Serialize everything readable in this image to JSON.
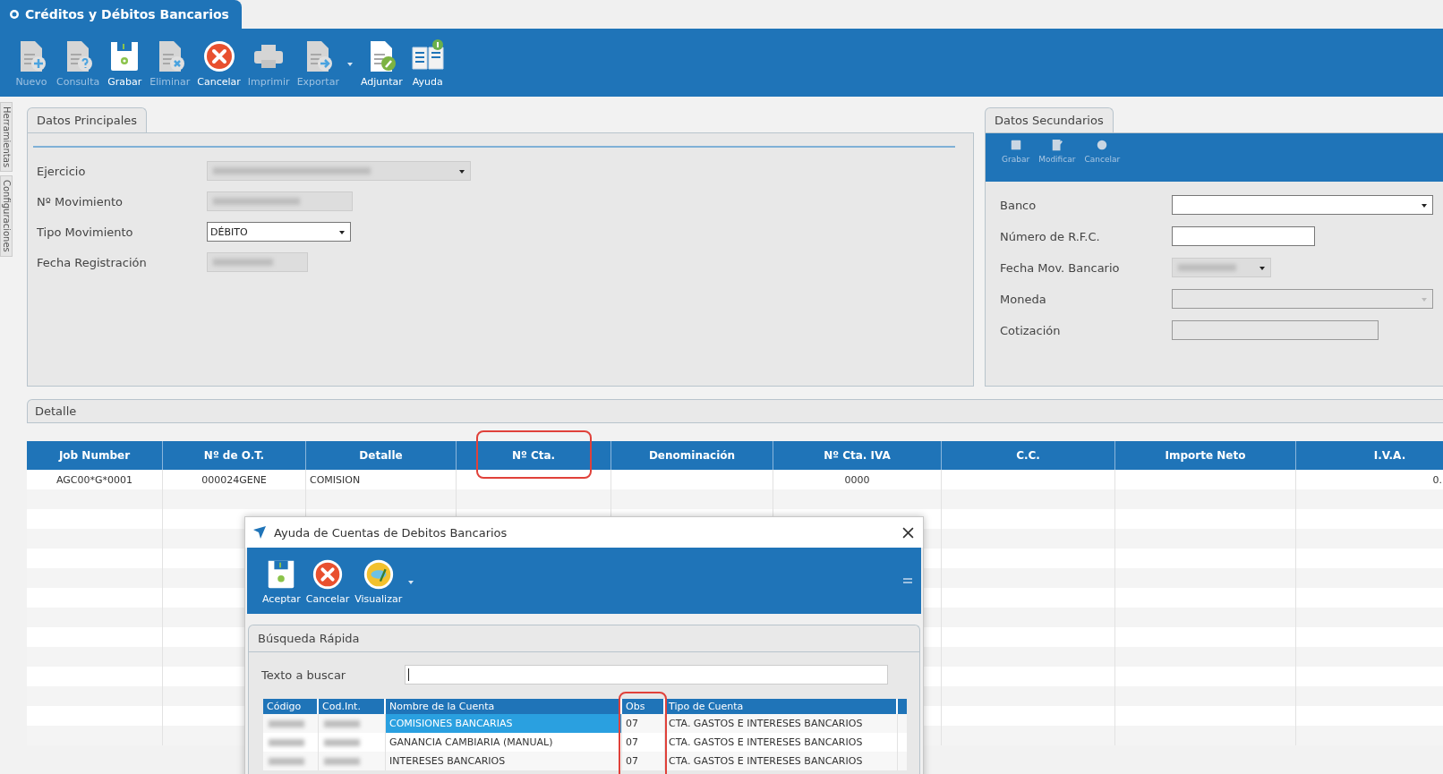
{
  "window": {
    "title": "Créditos y Débitos Bancarios"
  },
  "toolbar": [
    {
      "label": "Nuevo",
      "kind": "doc-plus",
      "disabled": true
    },
    {
      "label": "Consulta",
      "kind": "doc-question",
      "disabled": true
    },
    {
      "label": "Grabar",
      "kind": "save",
      "disabled": false
    },
    {
      "label": "Eliminar",
      "kind": "doc-x",
      "disabled": true
    },
    {
      "label": "Cancelar",
      "kind": "cancel",
      "disabled": false
    },
    {
      "label": "Imprimir",
      "kind": "printer",
      "disabled": true
    },
    {
      "label": "Exportar",
      "kind": "doc-arrow",
      "disabled": true,
      "dropdown": true
    },
    {
      "label": "Adjuntar",
      "kind": "attach",
      "disabled": false
    },
    {
      "label": "Ayuda",
      "kind": "help",
      "disabled": false
    }
  ],
  "side_tabs": [
    "Herramientas",
    "Configuraciones"
  ],
  "main_panel": {
    "tab": "Datos Principales",
    "fields": [
      {
        "label": "Ejercicio",
        "kind": "combo",
        "redacted": true
      },
      {
        "label": "Nº Movimiento",
        "kind": "text",
        "redacted": true
      },
      {
        "label": "Tipo Movimiento",
        "kind": "combo",
        "value": "DÉBITO",
        "redacted": false
      },
      {
        "label": "Fecha Registración",
        "kind": "text",
        "redacted": true
      }
    ]
  },
  "secondary_panel": {
    "tab": "Datos Secundarios",
    "toolbar": [
      "Grabar",
      "Modificar",
      "Cancelar"
    ],
    "fields": [
      {
        "label": "Banco",
        "kind": "combo",
        "disabled": false,
        "redacted": false
      },
      {
        "label": "Número de R.F.C.",
        "kind": "text",
        "disabled": false,
        "redacted": false
      },
      {
        "label": "Fecha Mov. Bancario",
        "kind": "combo",
        "disabled": false,
        "redacted": true
      },
      {
        "label": "Moneda",
        "kind": "combo",
        "disabled": true,
        "redacted": false
      },
      {
        "label": "Cotización",
        "kind": "text",
        "disabled": true,
        "redacted": false
      }
    ]
  },
  "detail": {
    "tab": "Detalle",
    "columns": [
      {
        "label": "Job Number",
        "highlighted": false
      },
      {
        "label": "Nº de O.T.",
        "highlighted": false
      },
      {
        "label": "Detalle",
        "highlighted": false
      },
      {
        "label": "Nº Cta.",
        "highlighted": true
      },
      {
        "label": "Denominación",
        "highlighted": false
      },
      {
        "label": "Nº  Cta. IVA",
        "highlighted": false
      },
      {
        "label": "C.C.",
        "highlighted": false
      },
      {
        "label": "Importe Neto",
        "highlighted": false
      },
      {
        "label": "I.V.A.",
        "highlighted": false
      }
    ],
    "rows": [
      {
        "cells": [
          "AGC00*G*0001",
          "000024GENE",
          "COMISION",
          "",
          "",
          "0000",
          "",
          "",
          "0."
        ]
      }
    ]
  },
  "dialog": {
    "title": "Ayuda de Cuentas de Debitos Bancarios",
    "toolbar": [
      {
        "label": "Aceptar",
        "kind": "save"
      },
      {
        "label": "Cancelar",
        "kind": "cancel"
      },
      {
        "label": "Visualizar",
        "kind": "view"
      }
    ],
    "tab": "Búsqueda Rápida",
    "search": {
      "label": "Texto a buscar"
    },
    "columns": [
      {
        "label": "Código",
        "highlighted": false
      },
      {
        "label": "Cod.Int.",
        "highlighted": false
      },
      {
        "label": "Nombre de la Cuenta",
        "highlighted": false
      },
      {
        "label": "Obs",
        "highlighted": true
      },
      {
        "label": "Tipo de Cuenta",
        "highlighted": false
      }
    ],
    "rows": [
      {
        "name": "COMISIONES BANCARIAS",
        "obs": "07",
        "type": "CTA. GASTOS E INTERESES BANCARIOS",
        "selected": true
      },
      {
        "name": "GANANCIA CAMBIARIA (MANUAL)",
        "obs": "07",
        "type": "CTA. GASTOS E INTERESES BANCARIOS",
        "selected": false
      },
      {
        "name": "INTERESES BANCARIOS",
        "obs": "07",
        "type": "CTA. GASTOS E INTERESES BANCARIOS",
        "selected": false
      }
    ]
  }
}
